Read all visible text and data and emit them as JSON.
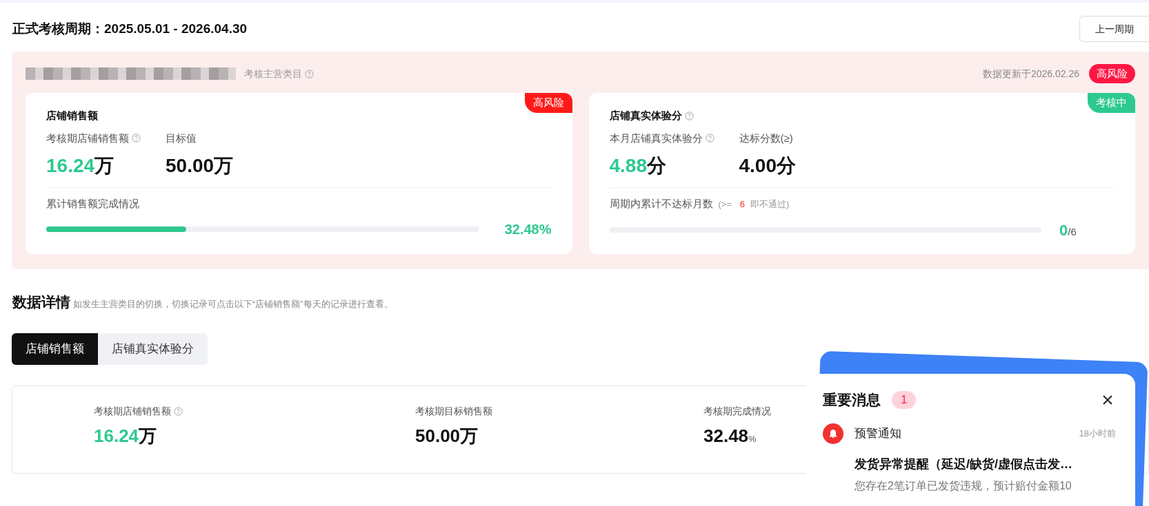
{
  "period": {
    "title": "正式考核周期：2025.05.01 - 2026.04.30",
    "prev_button": "上一周期"
  },
  "summary": {
    "category_label": "考核主营类目",
    "updated": "数据更新于2026.02.26",
    "risk_badge": "高风险",
    "cards": [
      {
        "kind": "progress",
        "title": "店铺销售额",
        "title_help": false,
        "corner": {
          "label": "高风险",
          "kind": "risk"
        },
        "metric_label": "考核期店铺销售额",
        "metric_value": "16.24",
        "metric_unit": "万",
        "target_label": "目标值",
        "target_value": "50.00",
        "target_unit": "万",
        "progress_label": "累计销售额完成情况",
        "level": 0.3248,
        "reading": "32.48%"
      },
      {
        "kind": "count",
        "title": "店铺真实体验分",
        "title_help": true,
        "corner": {
          "label": "考核中",
          "kind": "ongoing"
        },
        "metric_label": "本月店铺真实体验分",
        "metric_value": "4.88",
        "metric_unit": "分",
        "target_label": "达标分数(≥)",
        "target_value": "4.00",
        "target_unit": "分",
        "progress_label": "周期内累计不达标月数",
        "hint_prefix": "(>=",
        "hint_number": "6",
        "hint_suffix": "即不通过)",
        "level": 0,
        "reading": "0",
        "reading_total": "/6"
      }
    ]
  },
  "details": {
    "title": "数据详情",
    "note": "如发生主营类目的切换，切换记录可点击以下“店铺销售额”每天的记录进行查看。",
    "tabs": [
      {
        "label": "店铺销售额",
        "selected": true
      },
      {
        "label": "店铺真实体验分",
        "selected": false
      }
    ],
    "stats": [
      {
        "label": "考核期店铺销售额",
        "help": true,
        "value": "16.24",
        "unit": "万",
        "highlight": true
      },
      {
        "label": "考核期目标销售额",
        "help": false,
        "value": "50.00",
        "unit": "万",
        "highlight": false
      },
      {
        "label": "考核期完成情况",
        "help": false,
        "value": "32.48",
        "unit": "%",
        "highlight": false
      }
    ]
  },
  "popup": {
    "title": "重要消息",
    "count": "1",
    "messages": [
      {
        "type": "预警通知",
        "time": "18小时前",
        "headline": "发货异常提醒（延迟/缺货/虚假点击发…",
        "body": "您存在2笔订单已发货违规，预计赔付金额10"
      }
    ]
  }
}
